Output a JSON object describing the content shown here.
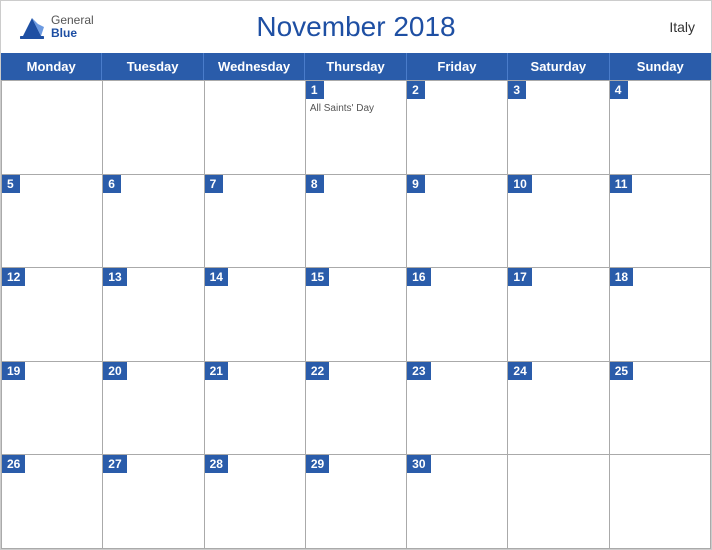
{
  "header": {
    "title": "November 2018",
    "country": "Italy",
    "logo": {
      "line1": "General",
      "line2": "Blue"
    }
  },
  "weekdays": [
    "Monday",
    "Tuesday",
    "Wednesday",
    "Thursday",
    "Friday",
    "Saturday",
    "Sunday"
  ],
  "weeks": [
    [
      {
        "day": "",
        "event": ""
      },
      {
        "day": "",
        "event": ""
      },
      {
        "day": "",
        "event": ""
      },
      {
        "day": "1",
        "event": "All Saints' Day"
      },
      {
        "day": "2",
        "event": ""
      },
      {
        "day": "3",
        "event": ""
      },
      {
        "day": "4",
        "event": ""
      }
    ],
    [
      {
        "day": "5",
        "event": ""
      },
      {
        "day": "6",
        "event": ""
      },
      {
        "day": "7",
        "event": ""
      },
      {
        "day": "8",
        "event": ""
      },
      {
        "day": "9",
        "event": ""
      },
      {
        "day": "10",
        "event": ""
      },
      {
        "day": "11",
        "event": ""
      }
    ],
    [
      {
        "day": "12",
        "event": ""
      },
      {
        "day": "13",
        "event": ""
      },
      {
        "day": "14",
        "event": ""
      },
      {
        "day": "15",
        "event": ""
      },
      {
        "day": "16",
        "event": ""
      },
      {
        "day": "17",
        "event": ""
      },
      {
        "day": "18",
        "event": ""
      }
    ],
    [
      {
        "day": "19",
        "event": ""
      },
      {
        "day": "20",
        "event": ""
      },
      {
        "day": "21",
        "event": ""
      },
      {
        "day": "22",
        "event": ""
      },
      {
        "day": "23",
        "event": ""
      },
      {
        "day": "24",
        "event": ""
      },
      {
        "day": "25",
        "event": ""
      }
    ],
    [
      {
        "day": "26",
        "event": ""
      },
      {
        "day": "27",
        "event": ""
      },
      {
        "day": "28",
        "event": ""
      },
      {
        "day": "29",
        "event": ""
      },
      {
        "day": "30",
        "event": ""
      },
      {
        "day": "",
        "event": ""
      },
      {
        "day": "",
        "event": ""
      }
    ]
  ]
}
